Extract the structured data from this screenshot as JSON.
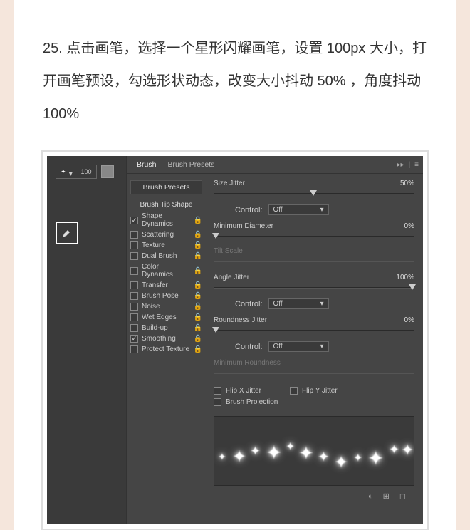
{
  "instruction": "25.  点击画笔，选择一个星形闪耀画笔，设置  100px  大小，打开画笔预设，勾选形状动态，改变大小抖动  50%  ，角度抖动  100%",
  "brush": {
    "size": "100"
  },
  "tabs": {
    "brush": "Brush",
    "presets": "Brush Presets"
  },
  "opts": {
    "presets": "Brush Presets",
    "tip": "Brush Tip Shape",
    "shape": "Shape Dynamics",
    "scatter": "Scattering",
    "texture": "Texture",
    "dual": "Dual Brush",
    "color": "Color Dynamics",
    "transfer": "Transfer",
    "pose": "Brush Pose",
    "noise": "Noise",
    "wet": "Wet Edges",
    "build": "Build-up",
    "smooth": "Smoothing",
    "protect": "Protect Texture"
  },
  "controls": {
    "size_jitter": {
      "label": "Size Jitter",
      "value": "50%"
    },
    "control": "Control:",
    "off": "Off",
    "min_diam": {
      "label": "Minimum Diameter",
      "value": "0%"
    },
    "tilt": "Tilt Scale",
    "angle_jitter": {
      "label": "Angle Jitter",
      "value": "100%"
    },
    "round_jitter": {
      "label": "Roundness Jitter",
      "value": "0%"
    },
    "min_round": "Minimum Roundness",
    "flipx": "Flip X Jitter",
    "flipy": "Flip Y Jitter",
    "proj": "Brush Projection"
  }
}
